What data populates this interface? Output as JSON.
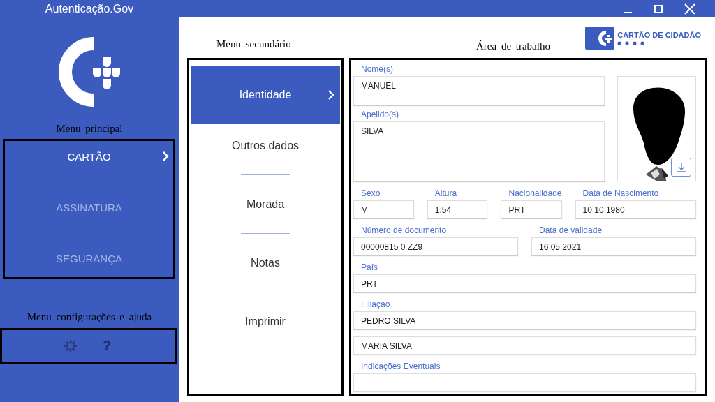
{
  "window": {
    "title": "Autenticação.Gov"
  },
  "annotations": {
    "main_menu": "Menu principal",
    "settings_menu": "Menu configurações e ajuda",
    "secondary_menu": "Menu secundário",
    "work_area": "Área de trabalho"
  },
  "main_menu": [
    {
      "label": "CARTÃO",
      "selected": true
    },
    {
      "label": "ASSINATURA",
      "selected": false
    },
    {
      "label": "SEGURANÇA",
      "selected": false
    }
  ],
  "help_button": "?",
  "brand": {
    "text": "CARTÃO DE CIDADÃO"
  },
  "secondary_menu": [
    {
      "label": "Identidade",
      "selected": true
    },
    {
      "label": "Outros dados",
      "selected": false
    },
    {
      "label": "Morada",
      "selected": false
    },
    {
      "label": "Notas",
      "selected": false
    },
    {
      "label": "Imprimir",
      "selected": false
    }
  ],
  "form": {
    "name": {
      "label": "Nome(s)",
      "value": "MANUEL"
    },
    "surname": {
      "label": "Apelido(s)",
      "value": "SILVA"
    },
    "photo": {
      "kind": "picture"
    },
    "rows": [
      [
        {
          "label": "Sexo",
          "value": "M"
        },
        {
          "label": "Altura",
          "value": "1,54"
        },
        {
          "label": "Nacionalidade",
          "value": "PRT"
        },
        {
          "label": "Data de Nascimento",
          "value": "10 10 1980"
        }
      ],
      [
        {
          "label": "Número de documento",
          "value": "00000815 0 ZZ9"
        },
        {
          "label": "Data de validade",
          "value": "16 05 2021"
        }
      ],
      [
        {
          "label": "País",
          "value": "PRT"
        }
      ],
      [
        {
          "label": "Filiação",
          "value": "PEDRO SILVA"
        }
      ],
      [
        {
          "value": "MARIA SILVA"
        }
      ],
      [
        {
          "label": "Indicações Eventuais"
        }
      ]
    ]
  }
}
